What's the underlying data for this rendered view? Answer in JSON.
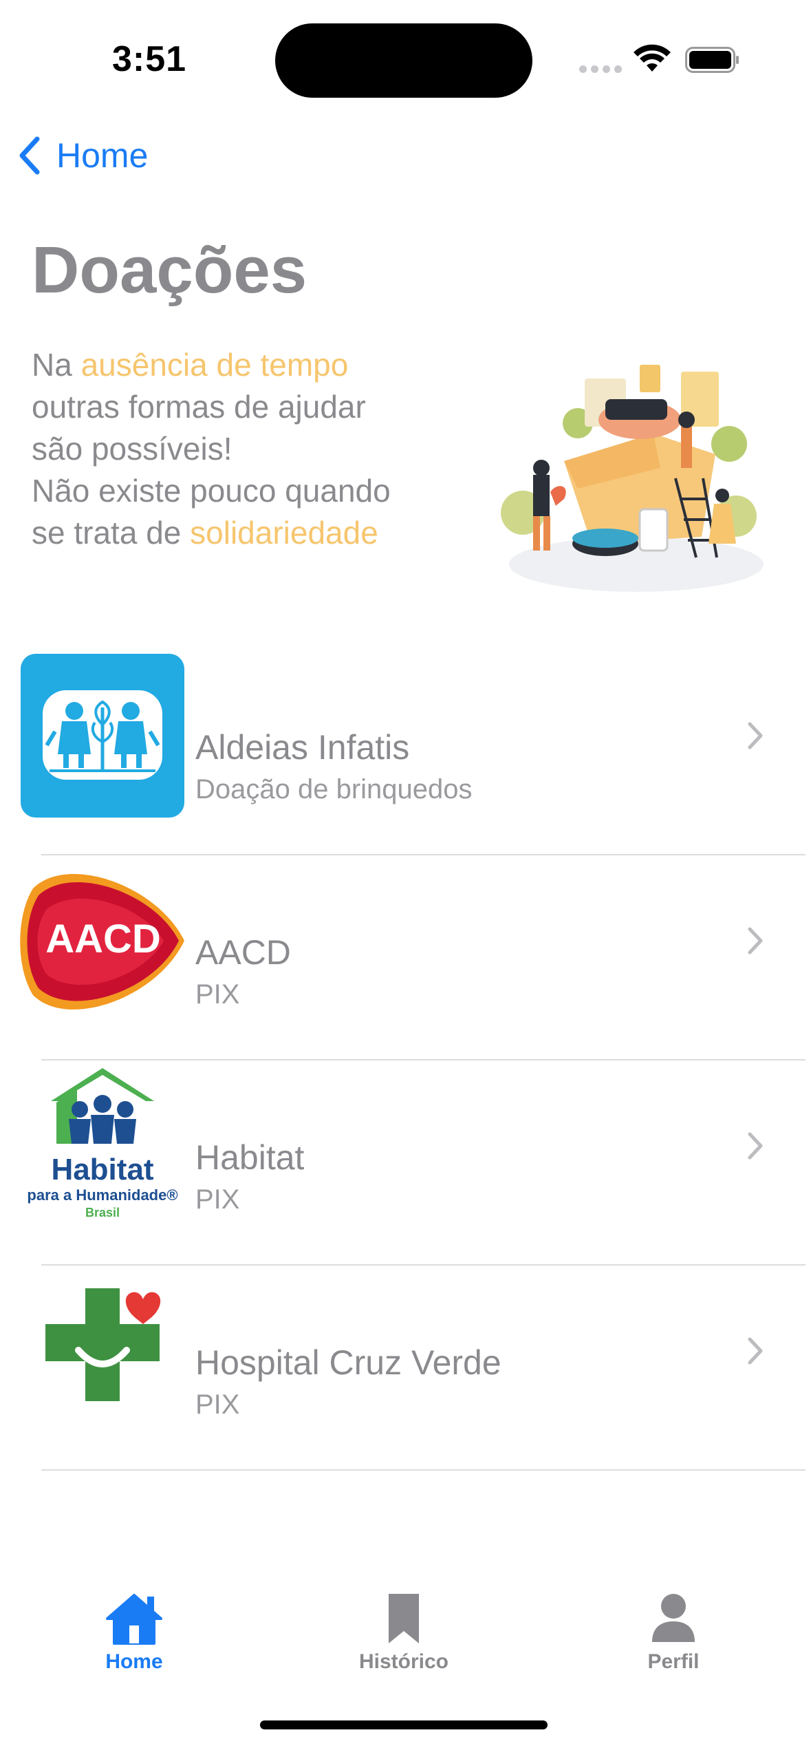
{
  "status_bar": {
    "time": "3:51"
  },
  "nav": {
    "back_label": "Home"
  },
  "title": "Doações",
  "hero": {
    "line1_prefix": "Na ",
    "line1_highlight": "ausência de tempo",
    "line2": "outras formas de ajudar",
    "line3": "são possíveis!",
    "line4": "Não existe pouco quando",
    "line5_prefix": "se trata de ",
    "line5_highlight": "solidariedade",
    "illustration_icon": "donation-box-illustration"
  },
  "organizations": [
    {
      "name": "Aldeias Infatis",
      "subtitle": "Doação de brinquedos",
      "logo": "aldeias-infantis-logo"
    },
    {
      "name": "AACD",
      "subtitle": "PIX",
      "logo": "aacd-logo",
      "logo_text": "AACD"
    },
    {
      "name": "Habitat",
      "subtitle": "PIX",
      "logo": "habitat-logo",
      "logo_text_1": "Habitat",
      "logo_text_2": "para a Humanidade®",
      "logo_text_3": "Brasil"
    },
    {
      "name": "Hospital Cruz Verde",
      "subtitle": "PIX",
      "logo": "cruz-verde-logo"
    }
  ],
  "tab_bar": {
    "tabs": [
      {
        "label": "Home",
        "icon": "house-icon",
        "active": true
      },
      {
        "label": "Histórico",
        "icon": "bookmark-icon",
        "active": false
      },
      {
        "label": "Perfil",
        "icon": "person-icon",
        "active": false
      }
    ]
  },
  "colors": {
    "accent": "#1a7cf5",
    "highlight": "#f6c56d",
    "text_gray": "#8a8a8e"
  }
}
